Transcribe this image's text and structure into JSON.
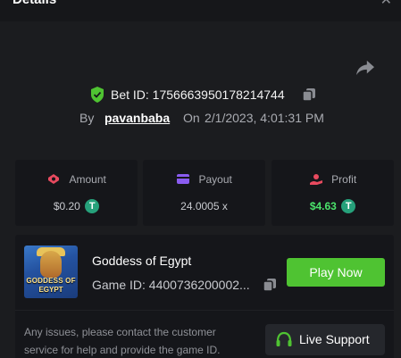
{
  "header": {
    "title": "Details",
    "close_icon": "close-icon"
  },
  "bet": {
    "id_text": "Bet ID: 1756663950178214744",
    "by_label": "By",
    "user": "pavanbaba",
    "on_label": "On",
    "date": "2/1/2023, 4:01:31 PM"
  },
  "stats": {
    "amount": {
      "label": "Amount",
      "value": "$0.20",
      "icon": "amount-icon"
    },
    "payout": {
      "label": "Payout",
      "value": "24.0005 x",
      "icon": "payout-card-icon"
    },
    "profit": {
      "label": "Profit",
      "value": "$4.63",
      "icon": "profit-icon"
    },
    "currency_symbol": "T"
  },
  "game": {
    "name": "Goddess of Egypt",
    "id_text": "Game ID: 4400736200002...",
    "thumb_line1": "GODDESS OF",
    "thumb_line2": "EGYPT",
    "play_label": "Play Now"
  },
  "support": {
    "help_text": "Any issues, please contact the customer service for help and provide the game ID.",
    "button_label": "Live Support"
  },
  "colors": {
    "background": "#1b1c1f",
    "card": "#15161a",
    "accent_green": "#4fc332",
    "profit_green": "#4be36b",
    "tether": "#26a17b"
  }
}
